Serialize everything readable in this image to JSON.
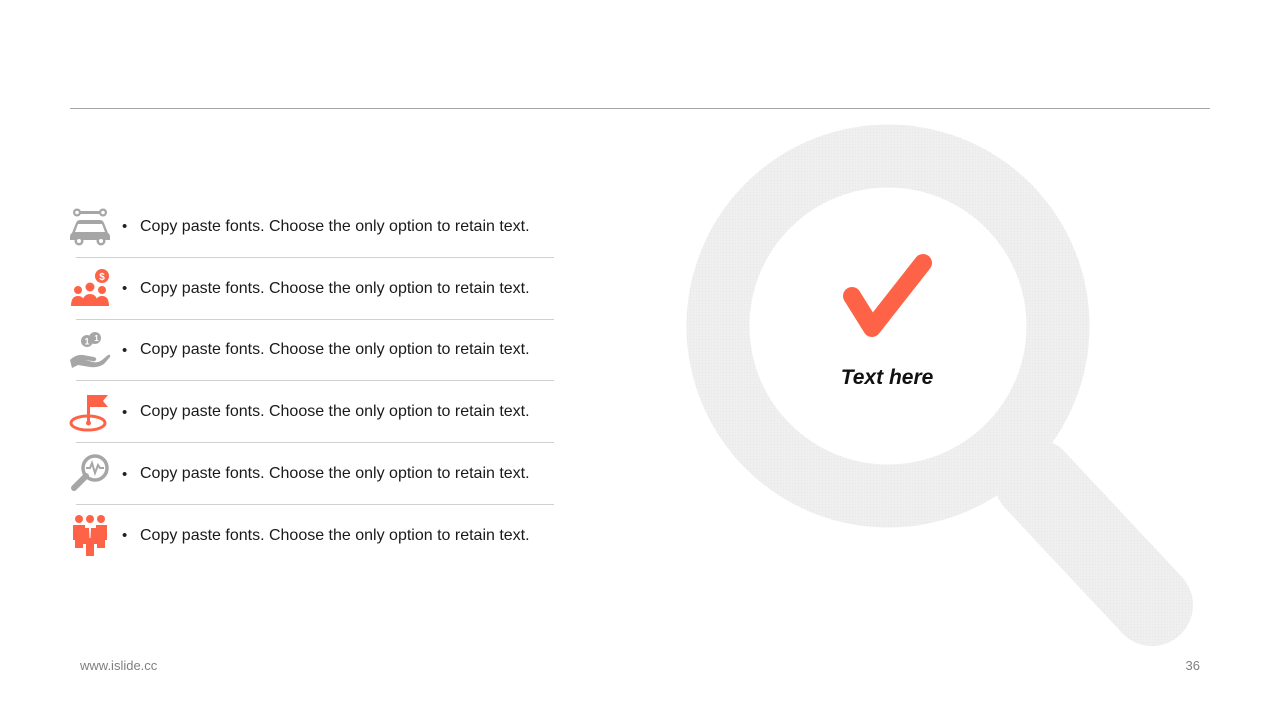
{
  "colors": {
    "accent": "#ff6347",
    "gray_icon": "#a6a6a6",
    "magnifier": "#efefef",
    "rule": "#a6a6a6"
  },
  "list": {
    "items": [
      {
        "icon": "car-wrench-icon",
        "text": "Copy paste fonts. Choose the only option to retain text."
      },
      {
        "icon": "team-dollar-icon",
        "text": "Copy paste fonts. Choose the only option to retain text."
      },
      {
        "icon": "hand-coins-icon",
        "text": "Copy paste fonts. Choose the only option to retain text."
      },
      {
        "icon": "flag-target-icon",
        "text": "Copy paste fonts. Choose the only option to retain text."
      },
      {
        "icon": "magnifier-pulse-icon",
        "text": "Copy paste fonts. Choose the only option to retain text."
      },
      {
        "icon": "business-team-icon",
        "text": "Copy paste fonts. Choose the only option to retain text."
      }
    ],
    "bullet": "•"
  },
  "graphic": {
    "label": "Text here",
    "icons": [
      "magnifier-icon",
      "checkmark-icon"
    ]
  },
  "footer": {
    "website": "www.islide.cc",
    "page_number": "36"
  }
}
